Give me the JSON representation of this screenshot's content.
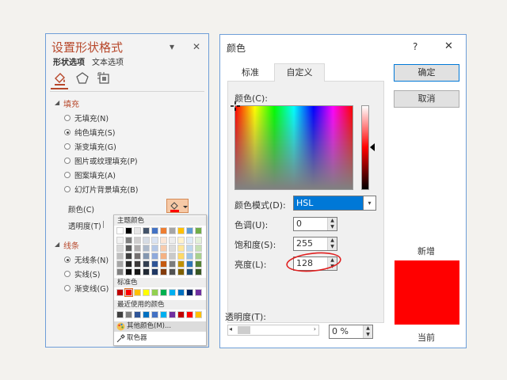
{
  "format_pane": {
    "title": "设置形状格式",
    "menu_arrow": "▾",
    "close": "✕",
    "tabs": [
      "形状选项",
      "文本选项"
    ],
    "fill_section": "填充",
    "fill_options": [
      {
        "label": "无填充(N)",
        "checked": false
      },
      {
        "label": "纯色填充(S)",
        "checked": true
      },
      {
        "label": "渐变填充(G)",
        "checked": false
      },
      {
        "label": "图片或纹理填充(P)",
        "checked": false
      },
      {
        "label": "图案填充(A)",
        "checked": false
      },
      {
        "label": "幻灯片背景填充(B)",
        "checked": false
      }
    ],
    "color_label": "颜色(C)",
    "transparency_label": "透明度(T)",
    "line_section": "线条",
    "line_options": [
      {
        "label": "无线条(N)",
        "checked": true
      },
      {
        "label": "实线(S)",
        "checked": false
      },
      {
        "label": "渐变线(G)",
        "checked": false
      }
    ]
  },
  "palette": {
    "theme_header": "主题颜色",
    "standard_header": "标准色",
    "recent_header": "最近使用的颜色",
    "more_colors": "其他颜色(M)...",
    "eyedropper": "取色器",
    "theme_top": [
      "#ffffff",
      "#000000",
      "#e7e6e6",
      "#44546a",
      "#4472c4",
      "#ed7d31",
      "#a5a5a5",
      "#ffc000",
      "#5b9bd5",
      "#70ad47"
    ],
    "theme_shades": [
      [
        "#f2f2f2",
        "#7f7f7f",
        "#d0cece",
        "#d6dce5",
        "#dae3f3",
        "#fbe5d6",
        "#ededed",
        "#fff2cc",
        "#deebf7",
        "#e2f0d9"
      ],
      [
        "#d9d9d9",
        "#595959",
        "#aeabab",
        "#adb9ca",
        "#b4c7e7",
        "#f8cbad",
        "#dbdbdb",
        "#ffe699",
        "#bdd7ee",
        "#c5e0b4"
      ],
      [
        "#bfbfbf",
        "#404040",
        "#757171",
        "#8497b0",
        "#8faadc",
        "#f4b183",
        "#c9c9c9",
        "#ffd966",
        "#9dc3e6",
        "#a9d18e"
      ],
      [
        "#a6a6a6",
        "#262626",
        "#3b3838",
        "#333f50",
        "#2f5597",
        "#c55a11",
        "#7b7b7b",
        "#bf9000",
        "#2e75b6",
        "#538135"
      ],
      [
        "#7f7f7f",
        "#0d0d0d",
        "#171717",
        "#222a35",
        "#203864",
        "#843c0c",
        "#525252",
        "#7f6000",
        "#1f4e79",
        "#385723"
      ]
    ],
    "standard": [
      "#c00000",
      "#ff0000",
      "#ffc000",
      "#ffff00",
      "#92d050",
      "#00b050",
      "#00b0f0",
      "#0070c0",
      "#002060",
      "#7030a0"
    ],
    "recent": [
      "#404040",
      "#7f7f7f",
      "#2f5597",
      "#0070c0",
      "#4472c4",
      "#00b0f0",
      "#7030a0",
      "#c00000",
      "#ff0000",
      "#ffc000"
    ]
  },
  "color_dialog": {
    "title": "颜色",
    "help": "?",
    "close": "✕",
    "tabs": [
      "标准",
      "自定义"
    ],
    "colors_label": "颜色(C):",
    "model_label": "颜色模式(D):",
    "model_value": "HSL",
    "hue_label": "色调(U):",
    "hue_value": "0",
    "sat_label": "饱和度(S):",
    "sat_value": "255",
    "lum_label": "亮度(L):",
    "lum_value": "128",
    "transparency_label": "透明度(T):",
    "transparency_value": "0 %",
    "ok": "确定",
    "cancel": "取消",
    "new_label": "新增",
    "current_label": "当前",
    "new_color": "#ff0000",
    "current_color": "#ff0000"
  }
}
